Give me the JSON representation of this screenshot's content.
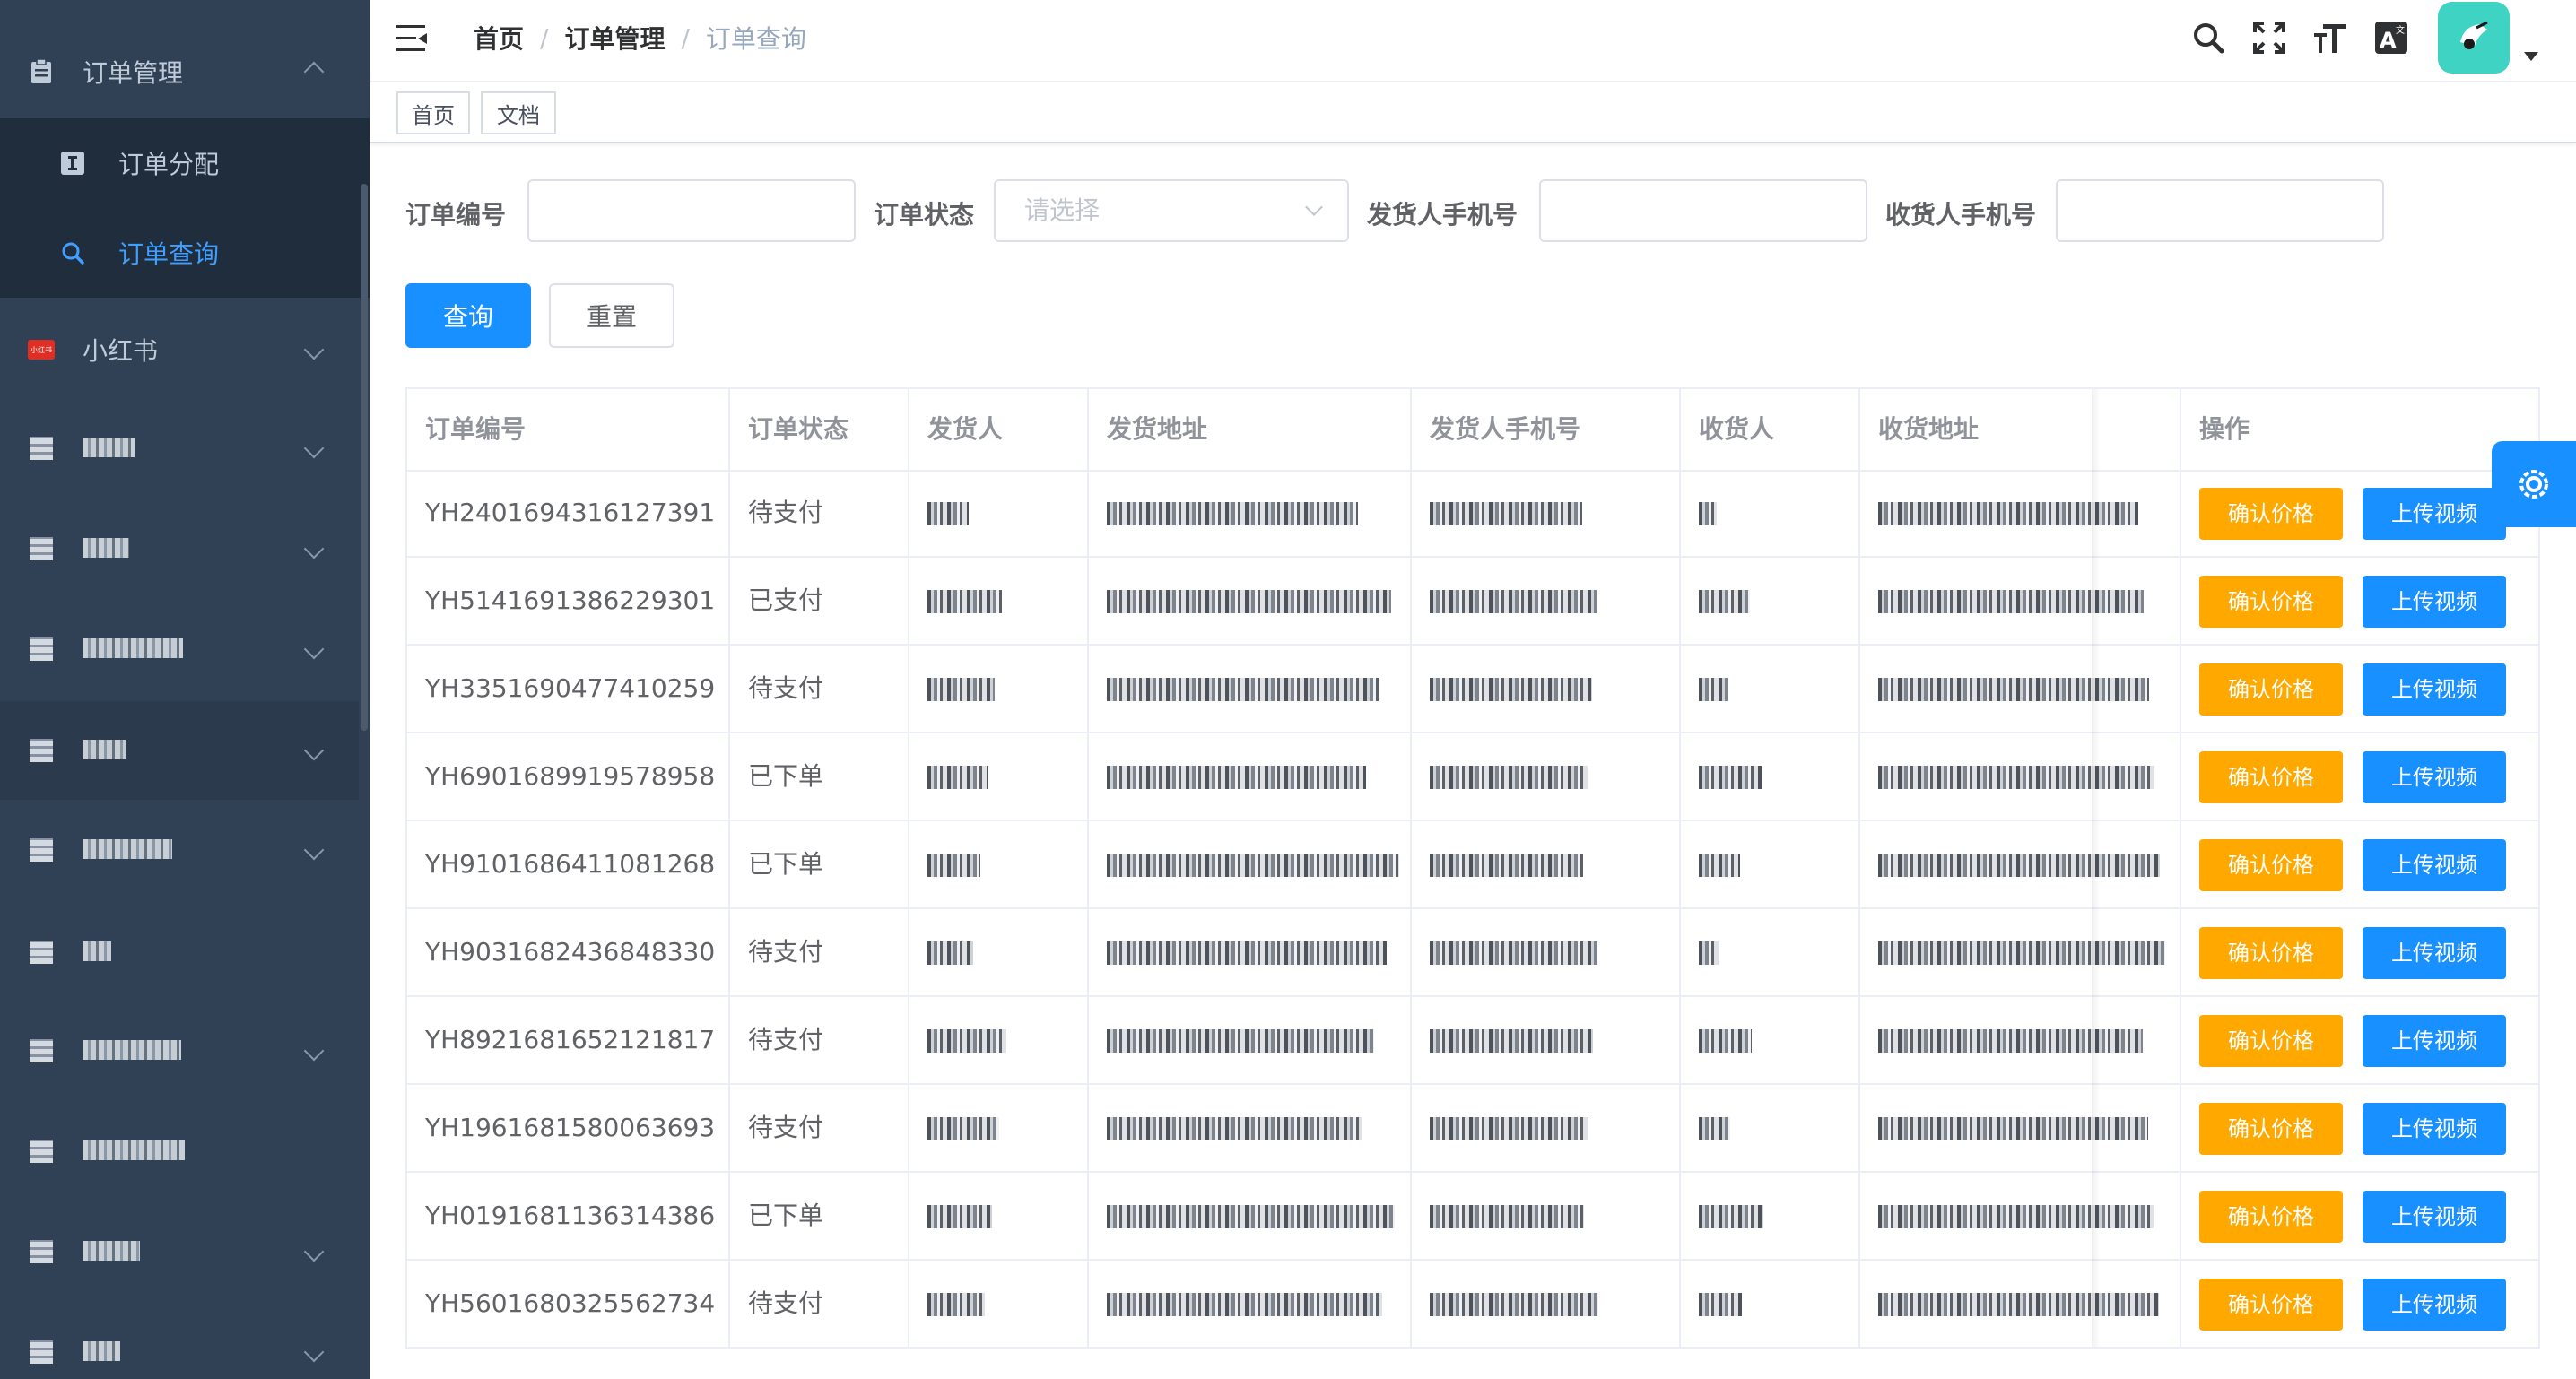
{
  "sidebar": {
    "groups": [
      {
        "label": "订单管理",
        "icon": "clipboard-icon",
        "expanded": true
      },
      {
        "label": "小红书",
        "icon": "xiaohongshu-logo-icon",
        "logo_text": "小红书"
      }
    ],
    "sub_items": [
      {
        "label": "订单分配",
        "icon": "info-icon"
      },
      {
        "label": "订单查询",
        "icon": "search-icon",
        "active": true
      }
    ]
  },
  "navbar": {
    "breadcrumb": [
      "首页",
      "订单管理",
      "订单查询"
    ],
    "separator": "/",
    "icons": [
      "search-icon",
      "fullscreen-icon",
      "font-size-icon",
      "language-icon"
    ]
  },
  "tags": [
    "首页",
    "文档"
  ],
  "search": {
    "order_no_label": "订单编号",
    "status_label": "订单状态",
    "status_placeholder": "请选择",
    "sender_phone_label": "发货人手机号",
    "receiver_phone_label": "收货人手机号",
    "query_button": "查询",
    "reset_button": "重置"
  },
  "table": {
    "headers": [
      "订单编号",
      "订单状态",
      "发货人",
      "发货地址",
      "发货人手机号",
      "收货人",
      "收货地址",
      "操作"
    ],
    "action_confirm": "确认价格",
    "action_upload": "上传视频",
    "rows": [
      {
        "order_no": "YH2401694316127391",
        "status": "待支付"
      },
      {
        "order_no": "YH5141691386229301",
        "status": "已支付"
      },
      {
        "order_no": "YH3351690477410259",
        "status": "待支付"
      },
      {
        "order_no": "YH6901689919578958",
        "status": "已下单"
      },
      {
        "order_no": "YH9101686411081268",
        "status": "已下单"
      },
      {
        "order_no": "YH9031682436848330",
        "status": "待支付"
      },
      {
        "order_no": "YH8921681652121817",
        "status": "待支付"
      },
      {
        "order_no": "YH1961681580063693",
        "status": "待支付"
      },
      {
        "order_no": "YH0191681136314386",
        "status": "已下单"
      },
      {
        "order_no": "YH5601680325562734",
        "status": "待支付"
      }
    ]
  },
  "colors": {
    "sidebar_bg": "#304156",
    "submenu_bg": "#1f2d3d",
    "active": "#409eff",
    "primary": "#1890ff",
    "warning": "#ffa800",
    "avatar_bg": "#3fd3c4"
  }
}
